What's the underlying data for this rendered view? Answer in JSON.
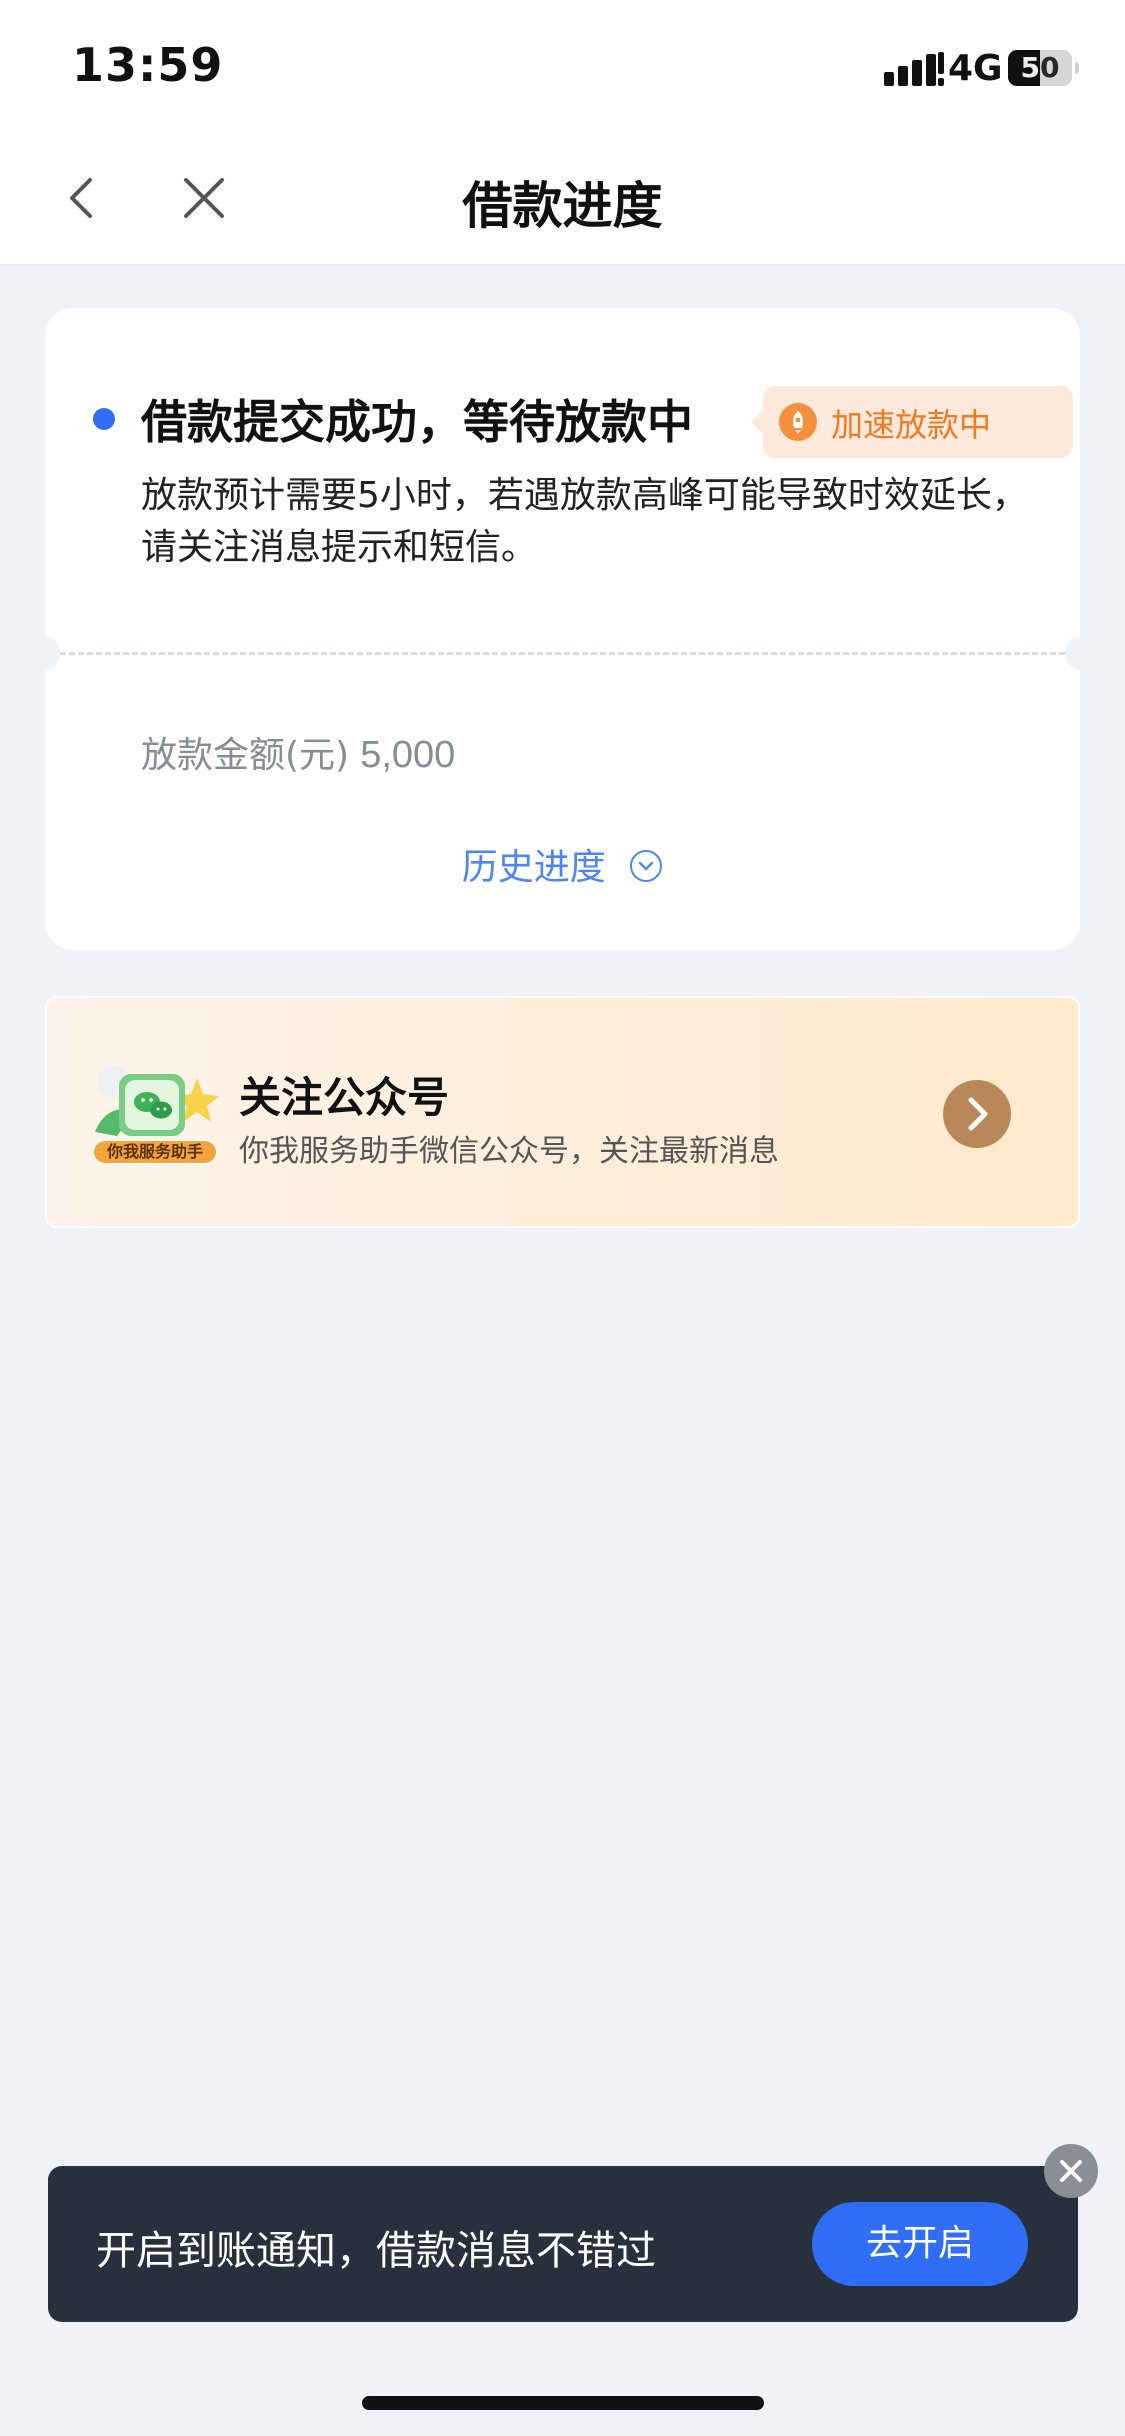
{
  "status_bar": {
    "time": "13:59",
    "network": "4G",
    "battery_level": "50"
  },
  "nav": {
    "title": "借款进度",
    "back_icon": "chevron-left-icon",
    "close_icon": "close-icon"
  },
  "progress_card": {
    "status_title": "借款提交成功，等待放款中",
    "badge_label": "加速放款中",
    "badge_icon": "rocket-icon",
    "description": "放款预计需要5小时，若遇放款高峰可能导致时效延长，请关注消息提示和短信。",
    "amount_label": "放款金额(元)",
    "amount_value": "5,000",
    "history_link": "历史进度",
    "colors": {
      "accent": "#2f6ef5",
      "badge_bg": "#fde9db",
      "badge_text": "#f07a1f"
    }
  },
  "follow_banner": {
    "title": "关注公众号",
    "description": "你我服务助手微信公众号，关注最新消息",
    "illustration_label": "你我服务助手",
    "arrow_icon": "chevron-right-circle-icon",
    "colors": {
      "arrow": "#b98758"
    }
  },
  "notification": {
    "message": "开启到账通知，借款消息不错过",
    "button_label": "去开启",
    "close_icon": "close-circle-icon",
    "colors": {
      "background": "#28303e",
      "button": "#2f6ef5"
    }
  }
}
